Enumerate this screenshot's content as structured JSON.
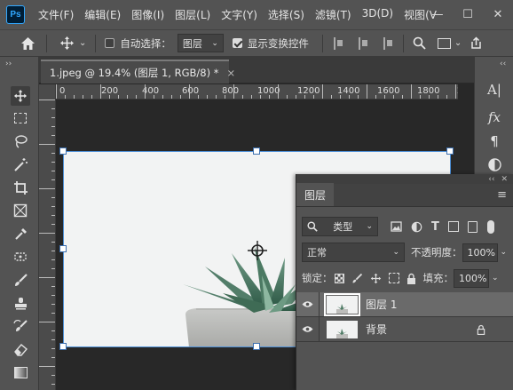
{
  "app": {
    "logo": "Ps"
  },
  "menu": [
    "文件(F)",
    "编辑(E)",
    "图像(I)",
    "图层(L)",
    "文字(Y)",
    "选择(S)",
    "滤镜(T)",
    "3D(D)",
    "视图(V"
  ],
  "window_controls": {
    "minimize": "—",
    "maximize": "☐",
    "close": "✕"
  },
  "options_bar": {
    "auto_select_label": "自动选择：",
    "auto_select_checked": false,
    "auto_select_value": "图层",
    "show_transform_label": "显示变换控件",
    "show_transform_checked": true
  },
  "document_tab": {
    "title": "1.jpeg @ 19.4% (图层 1, RGB/8) *",
    "close": "×"
  },
  "ruler": {
    "labels": [
      "0",
      "200",
      "400",
      "600",
      "800",
      "1000",
      "1200",
      "1400",
      "1600",
      "1800",
      "200"
    ]
  },
  "layers_panel": {
    "tab_label": "图层",
    "filter_kind": "类型",
    "blend_mode": "正常",
    "opacity_label": "不透明度：",
    "opacity_value": "100%",
    "lock_label": "锁定：",
    "fill_label": "填充：",
    "fill_value": "100%",
    "layers": [
      {
        "name": "图层 1",
        "visible": true,
        "selected": true,
        "locked": false
      },
      {
        "name": "背景",
        "visible": true,
        "selected": false,
        "locked": true
      }
    ]
  },
  "right_dock": {
    "char_label": "A|",
    "fx_label": "fx",
    "para_label": "¶"
  },
  "colors": {
    "selection_border": "#4d8fd6",
    "panel_bg": "#535353",
    "canvas_bg": "#282828",
    "accent": "#31a8ff"
  },
  "icons": [
    "home-icon",
    "move-icon",
    "search-icon",
    "share-icon",
    "eye-icon",
    "lock-icon",
    "brush-icon",
    "crop-icon",
    "eyedropper-icon",
    "eraser-icon",
    "lasso-icon",
    "marquee-icon",
    "magic-wand-icon",
    "frame-icon",
    "stamp-icon",
    "healing-icon"
  ]
}
